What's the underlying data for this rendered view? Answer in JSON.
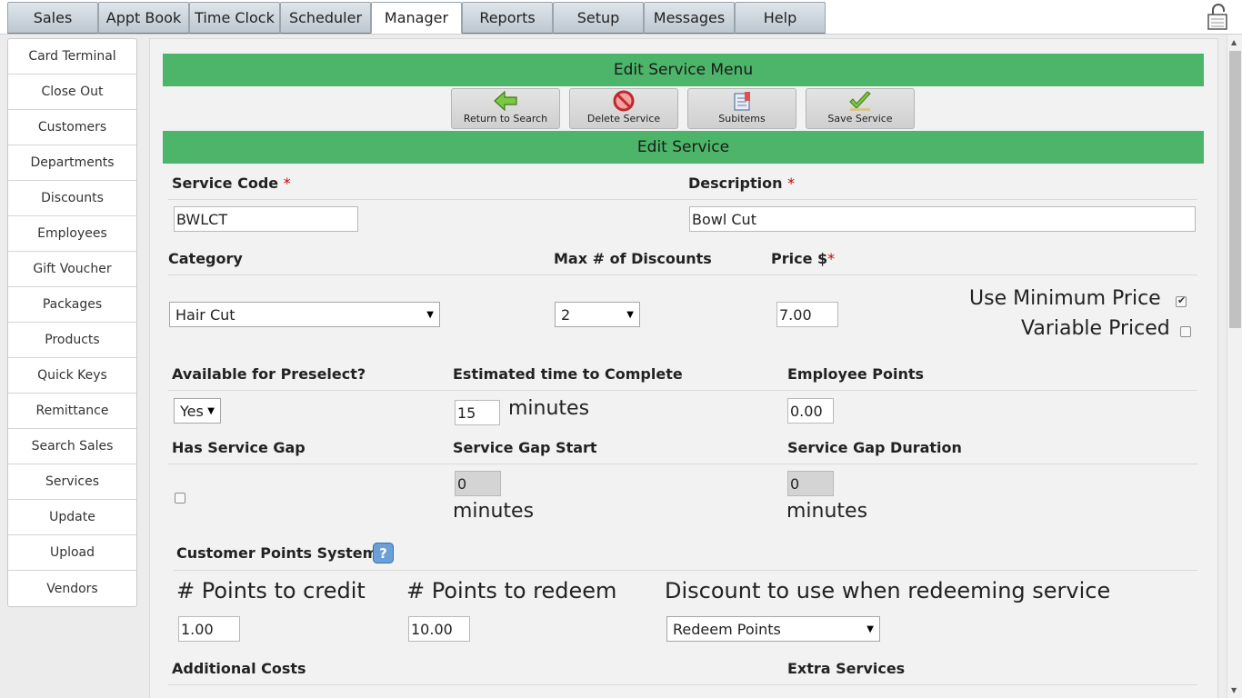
{
  "tabs": [
    "Sales",
    "Appt Book",
    "Time Clock",
    "Scheduler",
    "Manager",
    "Reports",
    "Setup",
    "Messages",
    "Help"
  ],
  "active_tab": "Manager",
  "sidenav": [
    "Card Terminal",
    "Close Out",
    "Customers",
    "Departments",
    "Discounts",
    "Employees",
    "Gift Voucher",
    "Packages",
    "Products",
    "Quick Keys",
    "Remittance",
    "Search Sales",
    "Services",
    "Update",
    "Upload",
    "Vendors"
  ],
  "menu_title": "Edit Service Menu",
  "toolbar": {
    "return": "Return to Search",
    "delete": "Delete Service",
    "subitems": "Subitems",
    "save": "Save Service"
  },
  "section_title": "Edit Service",
  "fields": {
    "service_code_label": "Service Code",
    "service_code_value": "BWLCT",
    "description_label": "Description",
    "description_value": "Bowl Cut",
    "required_mark": "*",
    "category_label": "Category",
    "category_value": "Hair Cut",
    "max_discounts_label": "Max # of Discounts",
    "max_discounts_value": "2",
    "price_label": "Price $",
    "price_value": "7.00",
    "use_min_price_label": "Use Minimum Price",
    "use_min_price_checked": true,
    "variable_priced_label": "Variable Priced",
    "variable_priced_checked": false,
    "preselect_label": "Available for Preselect?",
    "preselect_value": "Yes",
    "est_time_label": "Estimated time to Complete",
    "est_time_value": "15",
    "minutes": "minutes",
    "emp_points_label": "Employee Points",
    "emp_points_value": "0.00",
    "gap_label": "Has Service Gap",
    "gap_checked": false,
    "gap_start_label": "Service Gap Start",
    "gap_start_value": "0",
    "gap_duration_label": "Service Gap Duration",
    "gap_duration_value": "0",
    "points_system_label": "Customer Points System",
    "points_credit_label": "# Points to credit",
    "points_credit_value": "1.00",
    "points_redeem_label": "# Points to redeem",
    "points_redeem_value": "10.00",
    "discount_redeem_label": "Discount to use when redeeming service",
    "discount_redeem_value": "Redeem Points",
    "additional_costs_label": "Additional Costs",
    "extra_services_label": "Extra Services"
  },
  "colors": {
    "green_bar": "#4cb56a",
    "required": "#cc0000",
    "help_icon": "#6a9fd8"
  }
}
